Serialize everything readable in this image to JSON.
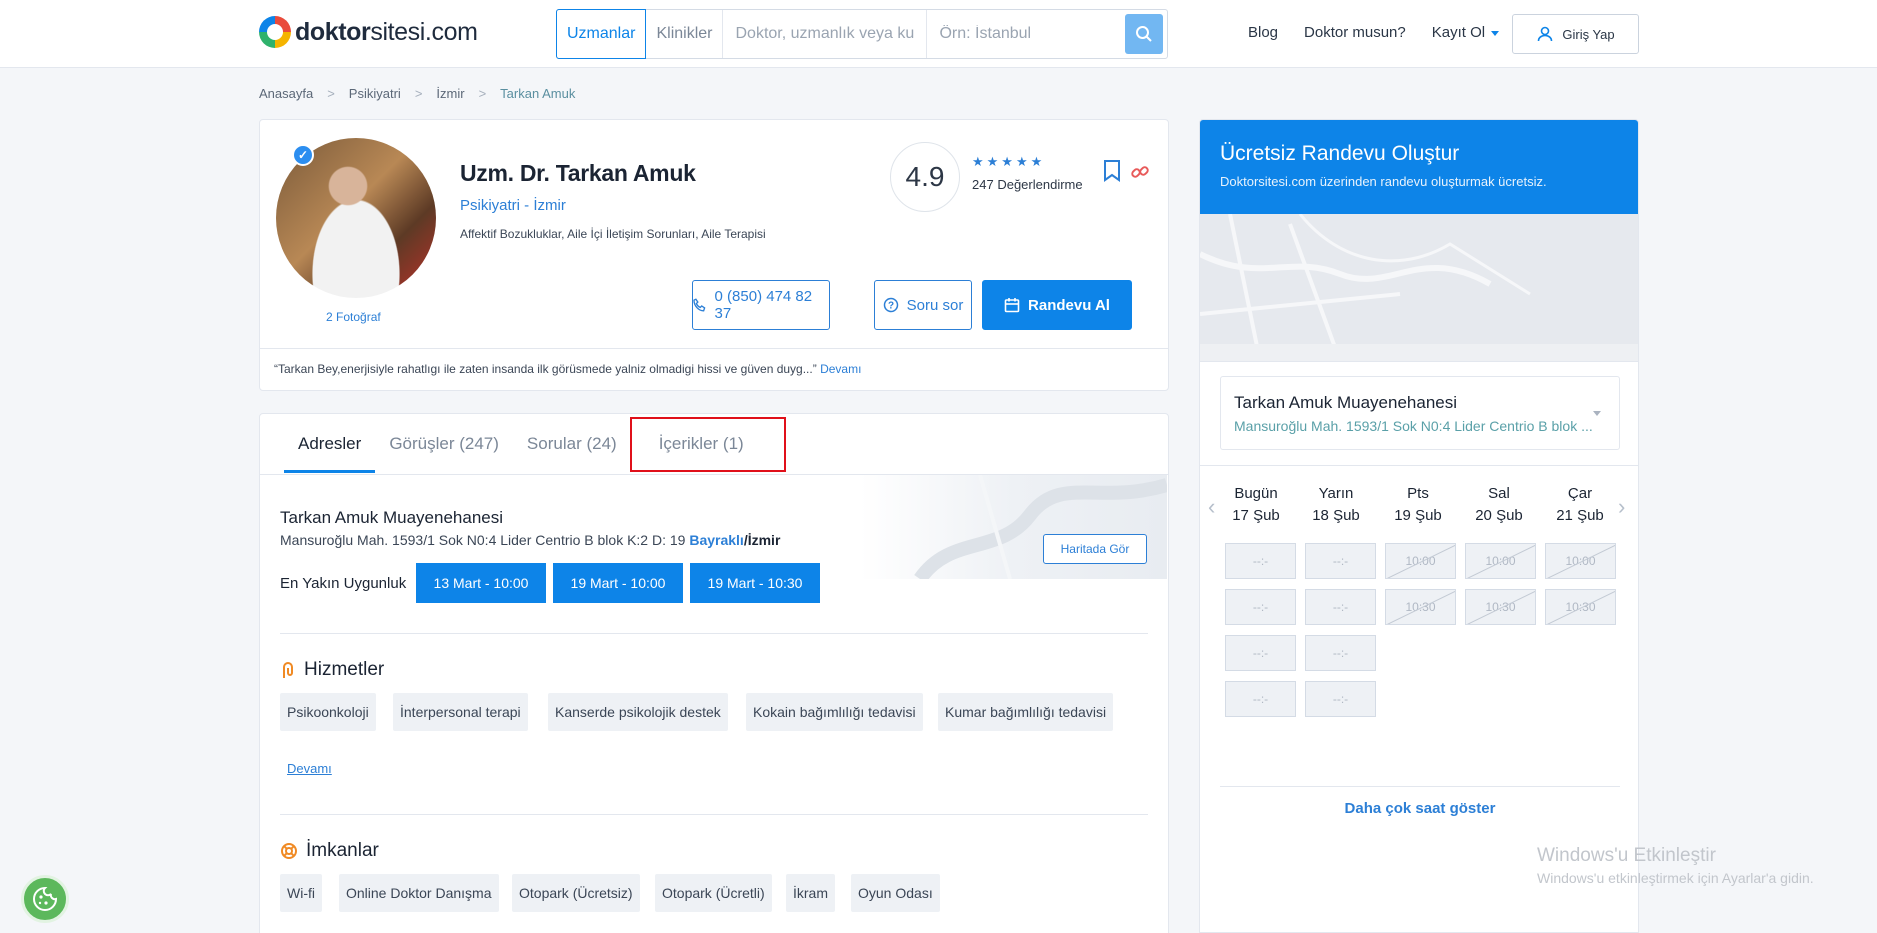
{
  "header": {
    "logo_bold": "doktor",
    "logo_rest": "sitesi.com",
    "search_tab_active": "Uzmanlar",
    "search_tab_other": "Klinikler",
    "search_placeholder": "Doktor, uzmanlık veya kuru",
    "location_placeholder": "Örn: İstanbul",
    "nav": [
      "Blog",
      "Doktor musun?",
      "Kayıt Ol"
    ],
    "login": "Giriş Yap"
  },
  "breadcrumb": [
    "Anasayfa",
    "Psikiyatri",
    "İzmir",
    "Tarkan Amuk"
  ],
  "profile": {
    "photos_count": "2",
    "photos_label": "Fotoğraf",
    "name": "Uzm. Dr. Tarkan Amuk",
    "specialty": "Psikiyatri - İzmir",
    "tags": "Affektif Bozukluklar, Aile İçi İletişim Sorunları, Aile Terapisi",
    "rating": "4.9",
    "reviews_count": "247",
    "reviews_label": "Değerlendirme",
    "phone": "0 (850) 474 82 37",
    "ask": "Soru sor",
    "book": "Randevu Al",
    "quote": "“Tarkan Bey,enerjisiyle rahatlıgı ile zaten insanda ilk görüsmede yalniz olmadigi hissi ve güven duyg...”",
    "quote_more": "Devamı"
  },
  "tabs": [
    "Adresler",
    "Görüşler (247)",
    "Sorular (24)",
    "İçerikler (1)"
  ],
  "address": {
    "title": "Tarkan Amuk Muayenehanesi",
    "line": "Mansuroğlu Mah. 1593/1 Sok N0:4 Lider Centrio B blok K:2 D: 19",
    "district": "Bayraklı",
    "city": "/İzmir",
    "map_button": "Haritada Gör",
    "nearest_label": "En Yakın Uygunluk",
    "slots": [
      "13 Mart - 10:00",
      "19 Mart - 10:00",
      "19 Mart - 10:30"
    ]
  },
  "services": {
    "title": "Hizmetler",
    "items": [
      "Psikoonkoloji",
      "İnterpersonal terapi",
      "Kanserde psikolojik destek",
      "Kokain bağımlılığı tedavisi",
      "Kumar bağımlılığı tedavisi"
    ],
    "more": "Devamı"
  },
  "facilities": {
    "title": "İmkanlar",
    "items": [
      "Wi-fi",
      "Online Doktor Danışma",
      "Otopark (Ücretsiz)",
      "Otopark (Ücretli)",
      "İkram",
      "Oyun Odası"
    ]
  },
  "appointment": {
    "title": "Ücretsiz Randevu Oluştur",
    "subtitle": "Doktorsitesi.com üzerinden randevu oluşturmak ücretsiz.",
    "clinic_name": "Tarkan Amuk Muayenehanesi",
    "clinic_address": "Mansuroğlu Mah. 1593/1 Sok N0:4 Lider Centrio B blok ...",
    "days": [
      {
        "name": "Bugün",
        "date": "17 Şub"
      },
      {
        "name": "Yarın",
        "date": "18 Şub"
      },
      {
        "name": "Pts",
        "date": "19 Şub"
      },
      {
        "name": "Sal",
        "date": "20 Şub"
      },
      {
        "name": "Çar",
        "date": "21 Şub"
      }
    ],
    "empty_slot": "--:-",
    "slot_a": "10:00",
    "slot_b": "10:30",
    "more_hours": "Daha çok saat göster"
  },
  "system": {
    "watermark_title": "Windows'u Etkinleştir",
    "watermark_sub": "Windows'u etkinleştirmek için Ayarlar'a gidin."
  },
  "colors": {
    "primary": "#0d84e8",
    "highlight": "#e0101a"
  }
}
